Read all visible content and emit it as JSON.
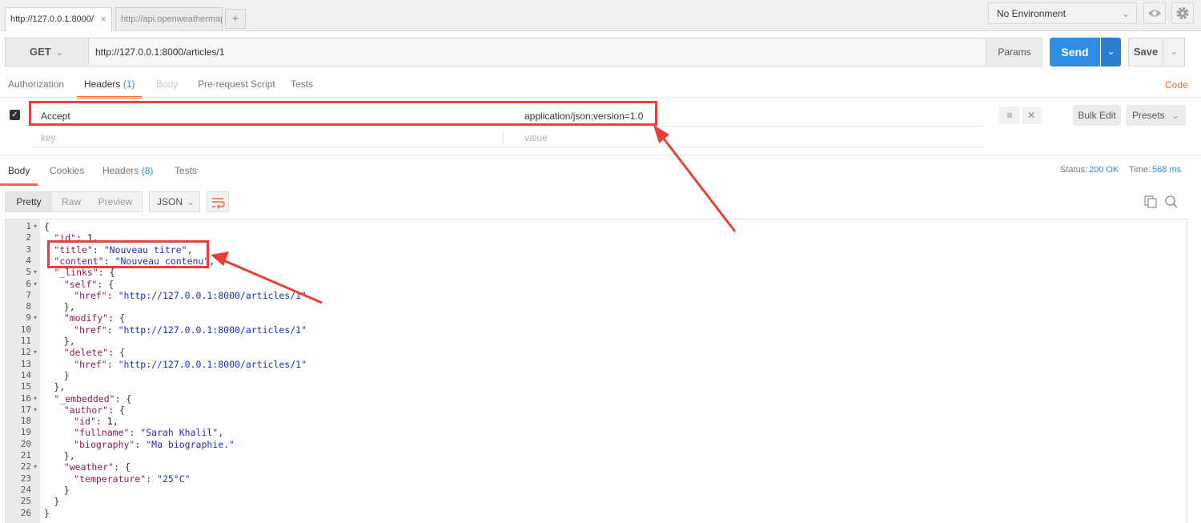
{
  "tabs": [
    {
      "label": "http://127.0.0.1:8000/",
      "active": true
    },
    {
      "label": "http://api.openweathermap",
      "active": false
    }
  ],
  "new_tab_label": "+",
  "environment": {
    "selected": "No Environment"
  },
  "request": {
    "method": "GET",
    "url": "http://127.0.0.1:8000/articles/1",
    "params_label": "Params",
    "send_label": "Send",
    "save_label": "Save"
  },
  "request_tabs": {
    "authorization": "Authorization",
    "headers": "Headers",
    "headers_count": "(1)",
    "body": "Body",
    "prerequest": "Pre-request Script",
    "tests": "Tests",
    "code": "Code"
  },
  "headers": {
    "rows": [
      {
        "key": "Accept",
        "value": "application/json;version=1.0"
      }
    ],
    "key_placeholder": "key",
    "value_placeholder": "value",
    "bulk_edit_label": "Bulk Edit",
    "presets_label": "Presets"
  },
  "response_tabs": {
    "body": "Body",
    "cookies": "Cookies",
    "headers": "Headers",
    "headers_count": "(8)",
    "tests": "Tests"
  },
  "response_status": {
    "status_label": "Status:",
    "status_value": "200 OK",
    "time_label": "Time:",
    "time_value": "568 ms"
  },
  "format": {
    "pretty": "Pretty",
    "raw": "Raw",
    "preview": "Preview",
    "language": "JSON"
  },
  "code_lines": [
    {
      "n": 1,
      "fold": true,
      "indent": 0,
      "parts": [
        [
          "p",
          "{"
        ]
      ]
    },
    {
      "n": 2,
      "fold": false,
      "indent": 1,
      "parts": [
        [
          "k",
          "\"id\""
        ],
        [
          "p",
          ": "
        ],
        [
          "n",
          "1"
        ],
        [
          "p",
          ","
        ]
      ]
    },
    {
      "n": 3,
      "fold": false,
      "indent": 1,
      "parts": [
        [
          "k",
          "\"title\""
        ],
        [
          "p",
          ": "
        ],
        [
          "s",
          "\"Nouveau titre\""
        ],
        [
          "p",
          ","
        ]
      ]
    },
    {
      "n": 4,
      "fold": false,
      "indent": 1,
      "parts": [
        [
          "k",
          "\"content\""
        ],
        [
          "p",
          ": "
        ],
        [
          "s",
          "\"Nouveau contenu\""
        ],
        [
          "p",
          ","
        ]
      ]
    },
    {
      "n": 5,
      "fold": true,
      "indent": 1,
      "parts": [
        [
          "k",
          "\"_links\""
        ],
        [
          "p",
          ": {"
        ]
      ]
    },
    {
      "n": 6,
      "fold": true,
      "indent": 2,
      "parts": [
        [
          "k",
          "\"self\""
        ],
        [
          "p",
          ": {"
        ]
      ]
    },
    {
      "n": 7,
      "fold": false,
      "indent": 3,
      "parts": [
        [
          "k",
          "\"href\""
        ],
        [
          "p",
          ": "
        ],
        [
          "s",
          "\"http://127.0.0.1:8000/articles/1\""
        ]
      ]
    },
    {
      "n": 8,
      "fold": false,
      "indent": 2,
      "parts": [
        [
          "p",
          "},"
        ]
      ]
    },
    {
      "n": 9,
      "fold": true,
      "indent": 2,
      "parts": [
        [
          "k",
          "\"modify\""
        ],
        [
          "p",
          ": {"
        ]
      ]
    },
    {
      "n": 10,
      "fold": false,
      "indent": 3,
      "parts": [
        [
          "k",
          "\"href\""
        ],
        [
          "p",
          ": "
        ],
        [
          "s",
          "\"http://127.0.0.1:8000/articles/1\""
        ]
      ]
    },
    {
      "n": 11,
      "fold": false,
      "indent": 2,
      "parts": [
        [
          "p",
          "},"
        ]
      ]
    },
    {
      "n": 12,
      "fold": true,
      "indent": 2,
      "parts": [
        [
          "k",
          "\"delete\""
        ],
        [
          "p",
          ": {"
        ]
      ]
    },
    {
      "n": 13,
      "fold": false,
      "indent": 3,
      "parts": [
        [
          "k",
          "\"href\""
        ],
        [
          "p",
          ": "
        ],
        [
          "s",
          "\"http://127.0.0.1:8000/articles/1\""
        ]
      ]
    },
    {
      "n": 14,
      "fold": false,
      "indent": 2,
      "parts": [
        [
          "p",
          "}"
        ]
      ]
    },
    {
      "n": 15,
      "fold": false,
      "indent": 1,
      "parts": [
        [
          "p",
          "},"
        ]
      ]
    },
    {
      "n": 16,
      "fold": true,
      "indent": 1,
      "parts": [
        [
          "k",
          "\"_embedded\""
        ],
        [
          "p",
          ": {"
        ]
      ]
    },
    {
      "n": 17,
      "fold": true,
      "indent": 2,
      "parts": [
        [
          "k",
          "\"author\""
        ],
        [
          "p",
          ": {"
        ]
      ]
    },
    {
      "n": 18,
      "fold": false,
      "indent": 3,
      "parts": [
        [
          "k",
          "\"id\""
        ],
        [
          "p",
          ": "
        ],
        [
          "n",
          "1"
        ],
        [
          "p",
          ","
        ]
      ]
    },
    {
      "n": 19,
      "fold": false,
      "indent": 3,
      "parts": [
        [
          "k",
          "\"fullname\""
        ],
        [
          "p",
          ": "
        ],
        [
          "s",
          "\"Sarah Khalil\""
        ],
        [
          "p",
          ","
        ]
      ]
    },
    {
      "n": 20,
      "fold": false,
      "indent": 3,
      "parts": [
        [
          "k",
          "\"biography\""
        ],
        [
          "p",
          ": "
        ],
        [
          "s",
          "\"Ma biographie.\""
        ]
      ]
    },
    {
      "n": 21,
      "fold": false,
      "indent": 2,
      "parts": [
        [
          "p",
          "},"
        ]
      ]
    },
    {
      "n": 22,
      "fold": true,
      "indent": 2,
      "parts": [
        [
          "k",
          "\"weather\""
        ],
        [
          "p",
          ": {"
        ]
      ]
    },
    {
      "n": 23,
      "fold": false,
      "indent": 3,
      "parts": [
        [
          "k",
          "\"temperature\""
        ],
        [
          "p",
          ": "
        ],
        [
          "s",
          "\"25°C\""
        ]
      ]
    },
    {
      "n": 24,
      "fold": false,
      "indent": 2,
      "parts": [
        [
          "p",
          "}"
        ]
      ]
    },
    {
      "n": 25,
      "fold": false,
      "indent": 1,
      "parts": [
        [
          "p",
          "}"
        ]
      ]
    },
    {
      "n": 26,
      "fold": false,
      "indent": 0,
      "parts": [
        [
          "p",
          "}"
        ]
      ]
    }
  ],
  "colors": {
    "accent": "#f26b3a",
    "send": "#2e8de6",
    "annotation": "#e8413b",
    "json_key": "#8b1c5a",
    "json_string": "#1a2fc7"
  }
}
